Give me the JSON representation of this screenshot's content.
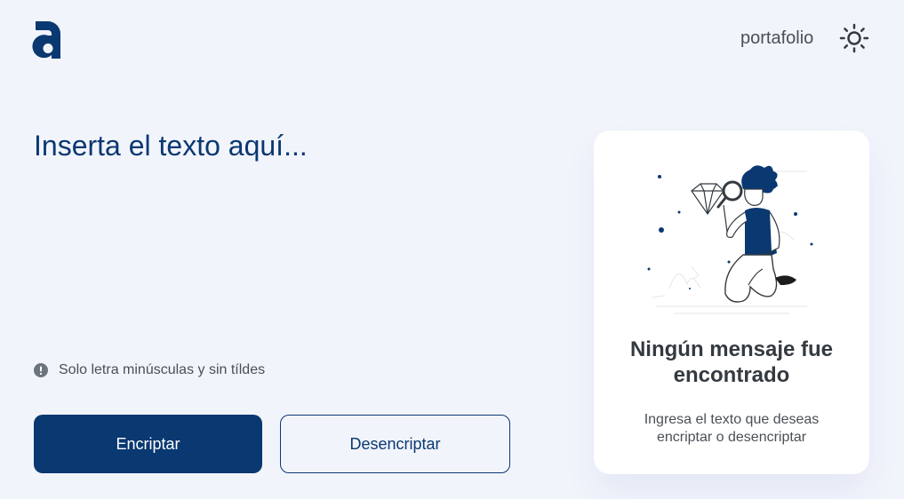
{
  "header": {
    "portfolio_label": "portafolio",
    "theme_icon": "sun-icon",
    "logo_icon": "alura-logo"
  },
  "editor": {
    "placeholder": "Inserta el texto aquí...",
    "value": ""
  },
  "hint": {
    "icon": "info-circle-icon",
    "text": "Solo letra minúsculas y sin tíldes"
  },
  "actions": {
    "encrypt_label": "Encriptar",
    "decrypt_label": "Desencriptar"
  },
  "result": {
    "title": "Ningún mensaje fue encontrado",
    "subtitle": "Ingresa el texto que deseas encriptar o desencriptar"
  },
  "colors": {
    "background": "#f2f4fc",
    "primary": "#0a3871",
    "text_gray": "#495057",
    "card": "#ffffff"
  }
}
